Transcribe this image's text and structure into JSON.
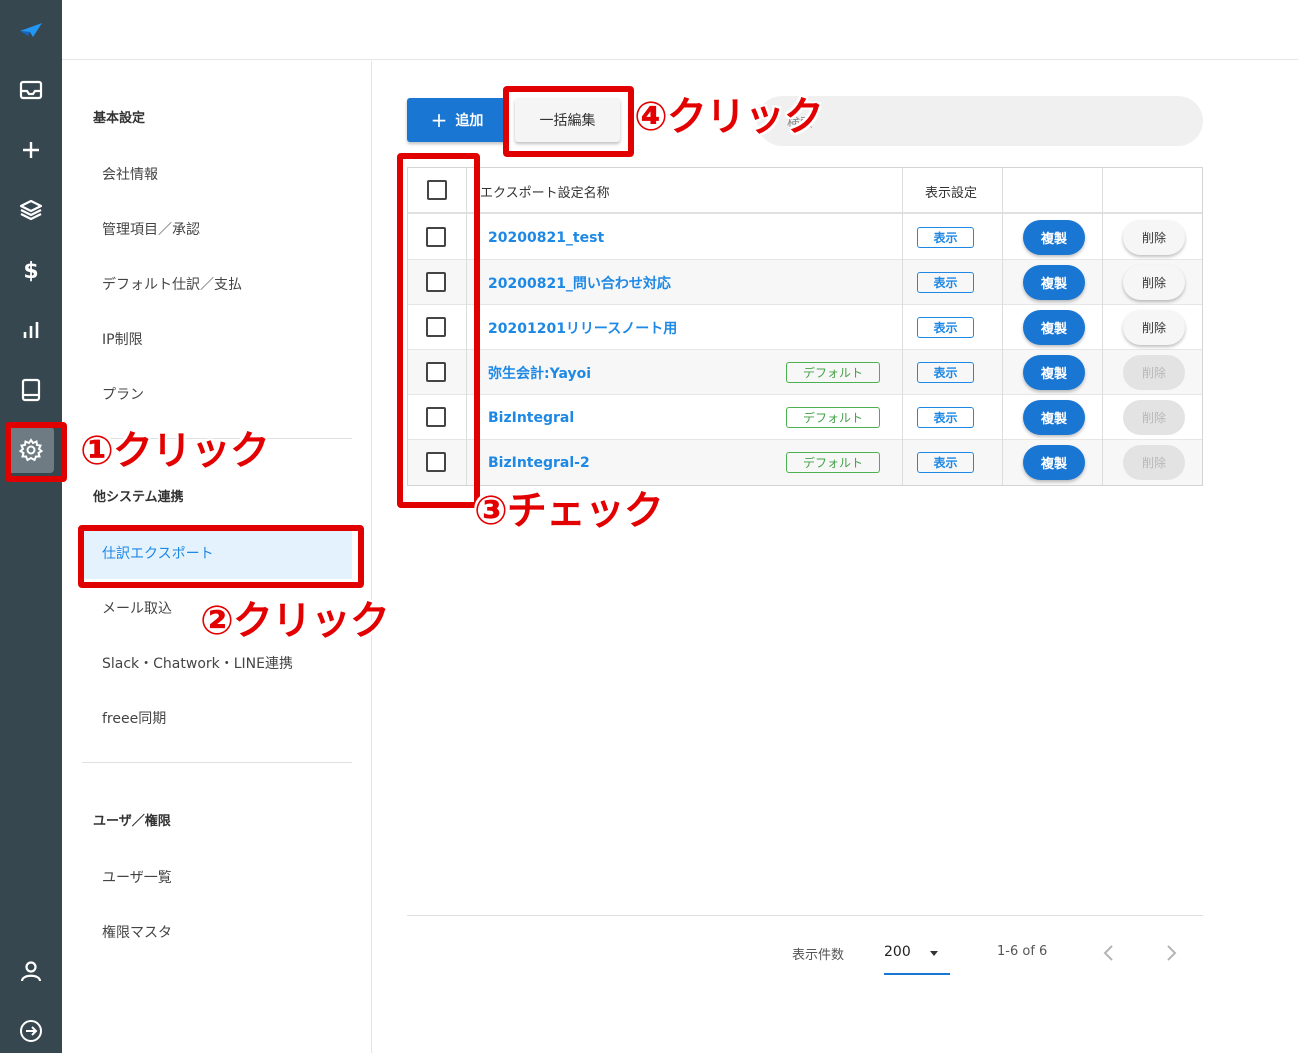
{
  "sidebar": {
    "sections": [
      {
        "title": "基本設定",
        "items": [
          "会社情報",
          "管理項目／承認",
          "デフォルト仕訳／支払",
          "IP制限",
          "プラン"
        ]
      },
      {
        "title": "他システム連携",
        "items": [
          "仕訳エクスポート",
          "メール取込",
          "Slack・Chatwork・LINE連携",
          "freee同期"
        ]
      },
      {
        "title": "ユーザ／権限",
        "items": [
          "ユーザ一覧",
          "権限マスタ"
        ]
      }
    ],
    "selected": "仕訳エクスポート"
  },
  "toolbar": {
    "add_label": "追加",
    "bulk_edit_label": "一括編集",
    "search_placeholder": "検索"
  },
  "table": {
    "headers": {
      "name": "エクスポート設定名称",
      "display": "表示設定"
    },
    "rows": [
      {
        "name": "20200821_test",
        "default": "",
        "display": "表示",
        "copy": "複製",
        "delete": "削除",
        "delete_enabled": true
      },
      {
        "name": "20200821_問い合わせ対応",
        "default": "",
        "display": "表示",
        "copy": "複製",
        "delete": "削除",
        "delete_enabled": true
      },
      {
        "name": "20201201リリースノート用",
        "default": "",
        "display": "表示",
        "copy": "複製",
        "delete": "削除",
        "delete_enabled": true
      },
      {
        "name": "弥生会計:Yayoi",
        "default": "デフォルト",
        "display": "表示",
        "copy": "複製",
        "delete": "削除",
        "delete_enabled": false
      },
      {
        "name": "BizIntegral",
        "default": "デフォルト",
        "display": "表示",
        "copy": "複製",
        "delete": "削除",
        "delete_enabled": false
      },
      {
        "name": "BizIntegral-2",
        "default": "デフォルト",
        "display": "表示",
        "copy": "複製",
        "delete": "削除",
        "delete_enabled": false
      }
    ]
  },
  "pagination": {
    "rows_per_page_label": "表示件数",
    "rows_per_page": "200",
    "range": "1-6 of 6"
  },
  "annotations": {
    "step1": "①クリック",
    "step2": "②クリック",
    "step3": "③チェック",
    "step4": "④クリック"
  },
  "colors": {
    "rail": "#37474f",
    "primary": "#1976d2",
    "link": "#1e88e5",
    "default_tag": "#43a047",
    "annotation": "#e00000",
    "selected_bg": "#e3f2fd"
  },
  "rail_icons": [
    "logo-icon",
    "inbox-icon",
    "plus-icon",
    "layers-icon",
    "dollar-icon",
    "chart-icon",
    "book-icon",
    "settings-icon",
    "user-icon",
    "logout-icon"
  ]
}
